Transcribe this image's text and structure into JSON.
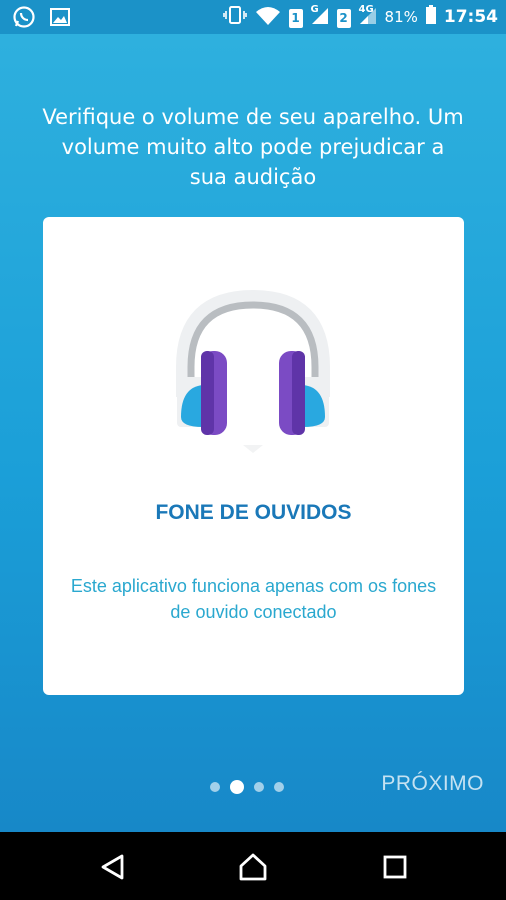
{
  "status_bar": {
    "sim1": "1",
    "sim1_network": "G",
    "sim2": "2",
    "sim2_network": "4G",
    "battery": "81%",
    "time": "17:54",
    "icons": [
      "whatsapp-icon",
      "image-icon",
      "vibrate-icon",
      "wifi-icon",
      "signal-icon",
      "battery-icon"
    ]
  },
  "intro": {
    "text": "Verifique o volume de seu aparelho. Um volume muito alto pode prejudicar a sua audição"
  },
  "card": {
    "icon": "headphones-icon",
    "title": "FONE DE OUVIDOS",
    "description": "Este aplicativo funciona apenas com os fones de ouvido conectado"
  },
  "pager": {
    "count": 4,
    "active_index": 1
  },
  "footer": {
    "next_label": "PRÓXIMO"
  },
  "nav_bar": {
    "icons": [
      "back-icon",
      "home-icon",
      "recents-icon"
    ]
  },
  "colors": {
    "background": "#1a9ad6",
    "title": "#1a78b8",
    "description": "#2aa8cf",
    "headphone_band": "#7b4bc4",
    "headphone_cup": "#29a8e0"
  }
}
